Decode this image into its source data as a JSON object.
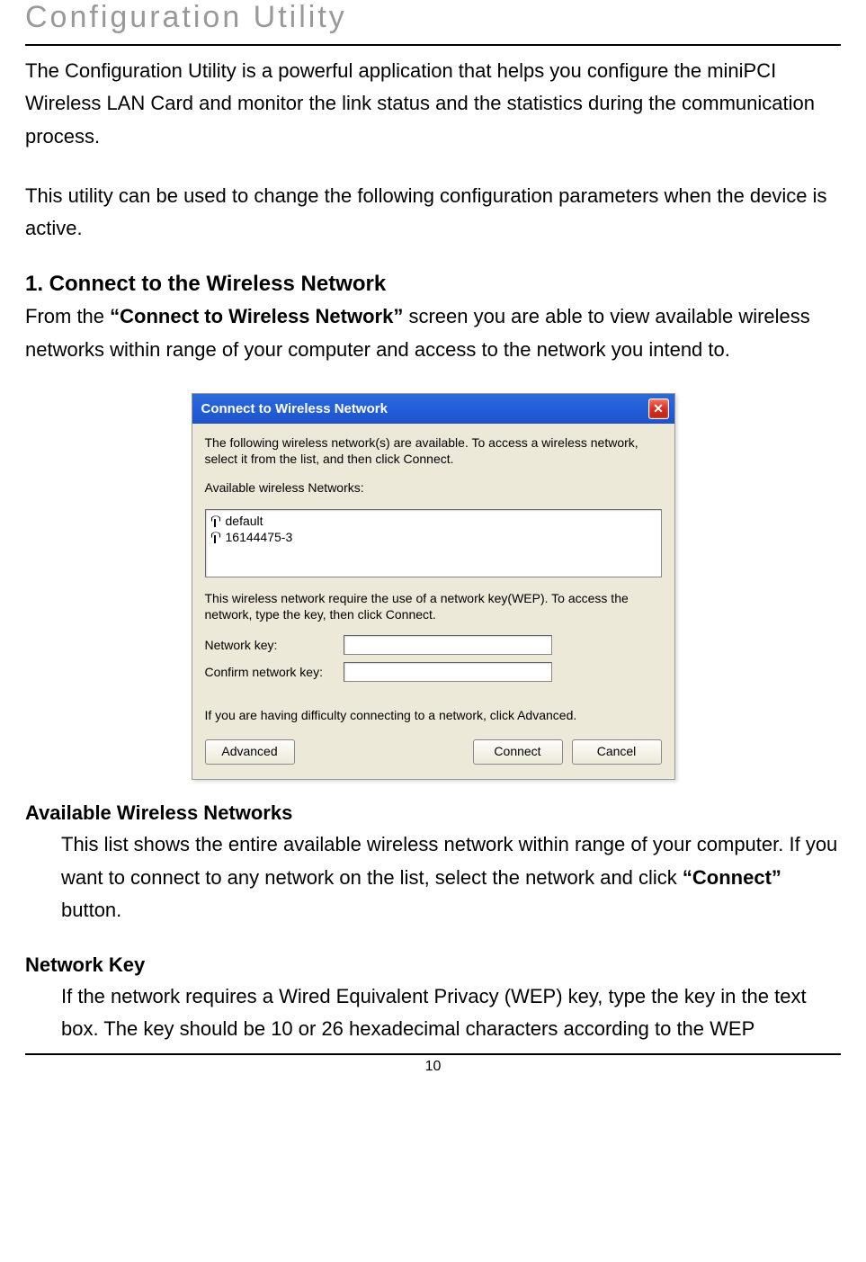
{
  "page": {
    "main_title": "Configuration Utility",
    "para1": "The Configuration Utility is a powerful application that helps you configure the miniPCI Wireless LAN Card and monitor the link status and the statistics during the communication process.",
    "para2": "This utility can be used to change the following configuration parameters when the device is active.",
    "section1_title": "1. Connect to the Wireless Network",
    "section1_pre": "From the ",
    "section1_bold": "“Connect to Wireless Network”",
    "section1_post": " screen you are able to view available wireless networks within range of your computer and access to the network you intend to.",
    "sub1_title": "Available Wireless Networks",
    "sub1_pre": "This list shows the entire available wireless network within range of your computer. If you want to connect to any network on the list, select the network and click ",
    "sub1_bold": "“Connect”",
    "sub1_post": " button.",
    "sub2_title": "Network Key",
    "sub2_text": "If the network requires a Wired Equivalent Privacy (WEP) key, type the key in the text box. The key should be 10 or 26 hexadecimal characters according to the WEP",
    "page_number": "10"
  },
  "dialog": {
    "title": "Connect to Wireless Network",
    "intro": "The following wireless network(s) are available. To access a wireless network, select it from the list, and then click Connect.",
    "list_label": "Available wireless Networks:",
    "items": [
      "default",
      "16144475-3"
    ],
    "wep_text": "This wireless network require the use of a network key(WEP). To access the network, type the key, then click Connect.",
    "key_label": "Network key:",
    "confirm_label": "Confirm network key:",
    "difficulty": "If you are having difficulty connecting to a network, click Advanced.",
    "btn_advanced": "Advanced",
    "btn_connect": "Connect",
    "btn_cancel": "Cancel"
  }
}
